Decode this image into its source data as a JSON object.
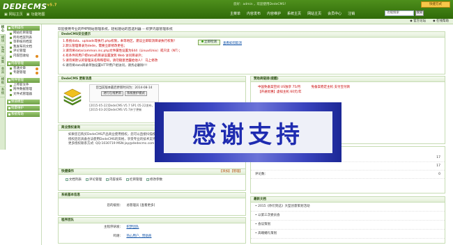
{
  "header": {
    "logo": "DEDECMS",
    "version": "v5.7",
    "top_links": [
      "网站主页",
      "功能地图"
    ],
    "welcome": "您好：admin ，欢迎使用DedeCMS！",
    "welcome_links": [
      "网站主页",
      "会员中心",
      "注销"
    ],
    "skin_button": "快捷方式",
    "nav": [
      "主菜单",
      "内容发布",
      "内容维护",
      "系统主页",
      "网站主页",
      "会员中心",
      "注销"
    ],
    "search_placeholder": "功能搜索",
    "search_button": "搜索",
    "sub_right": [
      "官方论坛",
      "在线帮助"
    ]
  },
  "vtabs": [
    "核心",
    "模块",
    "生成",
    "采集",
    "会员",
    "模板",
    "系统"
  ],
  "sidebar": [
    {
      "title": "常用操作",
      "items": [
        "网站栏目管理",
        "所有档案列表",
        "等审核的档案",
        "我发布的文档",
        "评论管理",
        "内容回收站"
      ]
    },
    {
      "title": "内容管理",
      "items": [
        "普通文章",
        "专题管理"
      ]
    },
    {
      "title": "附件管理",
      "items": [
        "上传新文件",
        "附件数据管理",
        "文件式管理器"
      ]
    },
    {
      "title": "频道模型",
      "items": []
    },
    {
      "title": "批量维护",
      "items": []
    },
    {
      "title": "系统帮助",
      "items": []
    }
  ],
  "main": {
    "welcome_text": "欢迎使用专业的PHP网站管理系统，轻松建站的首选利器 -- 织梦内容管理系统",
    "security": {
      "title": "DedeCMS安全提示",
      "lines": [
        "1.系统data、uploads等执行.php权限，本等地区，建议立即取消目录执行权限！",
        "2.默认管理目录为dede，需要立即修改更名；",
        "3.请勿将data/common.inc.php文件属性设置为644（Linux/Unix）或只读（NT）；",
        "4.有条件的用户把data的目录设置放到 Web 访问目录外；",
        "5.请勿将默认的管理员名称和密码，请勿随意泄露给他人！ 马上修改",
        "6.请勿将data目录单独设置HTTP用户组访问，请务必删除!!!"
      ],
      "fix_button": "立即检测",
      "view_fix": "查看如何取消"
    },
    "update": {
      "title": "DedeCMS 更新消息",
      "box_line1": "您当前版本最后更新时间为：2014-08-14",
      "btn1": "进行在线更新",
      "btn2": "系统维护模式",
      "version_text": "[2015-05-22]DedeCMS V5.7 SP1 05-22发布，快去官方下载最新安装包，进行系统升级，获取更多技术支持与服务 [2015-03-20]DedeCMS V5.7补丁更新"
    },
    "license": {
      "title": "商业授权查询",
      "lines": [
        "如果您已购买DedeCMS产品商业使用授权，您可以直接扫描授权证书申请网站正规授权证书",
        "授权后您具备合法使用DedeCMS的资格，享受专业的技术支持服务与在线",
        "更多授权联系方式: QQ:1030719 MSN:jay@dedecms.com TEL:0755-2671xxxx"
      ]
    },
    "quick": {
      "title": "快捷操作",
      "right": "【添加】【管理】",
      "items": [
        "文档列表",
        "评论管理",
        "内容发布",
        "栏目管理",
        "修改参数"
      ]
    },
    "sysinfo": {
      "title": "系统基本信息",
      "label": "您的级别：",
      "value": "总管理员 [查看更多]"
    },
    "team": {
      "title": "程序团队",
      "rows": [
        {
          "label": "主程序研发：",
          "value": "织梦团队"
        },
        {
          "label": "鸣谢：",
          "value": "热心用户、赞助商"
        }
      ]
    },
    "ads": {
      "title": "赞助商链接(提醒)",
      "col1": [
        "中国免备案空间 US独享 75/月",
        "【开通优惠】虚拟主机 60元/年"
      ],
      "col2": [
        "免备案稳定主机 支付宝付款"
      ]
    },
    "stats": {
      "values": [
        "17",
        "17",
        "0"
      ],
      "label": "评论数："
    },
    "news": {
      "title": "最新文档",
      "items": [
        "2015《你们到这》大型创意策划活动",
        "以第三次委员会",
        "会议策划",
        "高端婚礼策划",
        "宴会策划",
        "订婚宴策划"
      ]
    }
  },
  "overlay": {
    "text": "感谢支持"
  }
}
